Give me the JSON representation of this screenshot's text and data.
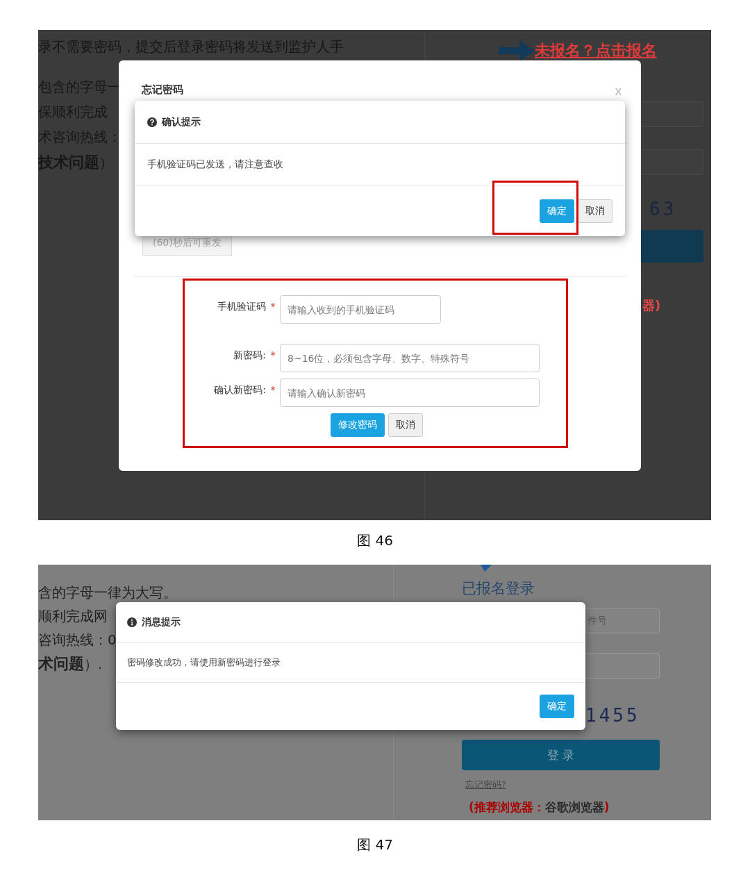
{
  "figure_46": {
    "caption": "图 46",
    "page_behind": {
      "top_text": "录不需要密码，提交后登录密码将发送到监护人手",
      "notice_lines": [
        "包含的字母一",
        "保顺利完成",
        "术咨询热线：",
        "**技术问题**）"
      ],
      "register_link": "未报名？点击报名",
      "captcha": "63",
      "browser_note_tail": "器)"
    },
    "forgot_password_modal": {
      "title": "忘记密码",
      "close": "x",
      "resend_button": {
        "label": "(60)秒后可重发",
        "disabled": true
      },
      "form_highlighted": true,
      "fields": [
        {
          "label": "手机验证码",
          "required_mark": "*",
          "placeholder": "请输入收到的手机验证码",
          "kind": "short"
        },
        {
          "label": "新密码:",
          "required_mark": "*",
          "placeholder": "8~16位，必须包含字母、数字、特殊符号",
          "kind": "long"
        },
        {
          "label": "确认新密码:",
          "required_mark": "*",
          "placeholder": "请输入确认新密码",
          "kind": "long"
        }
      ],
      "buttons": [
        {
          "label": "修改密码",
          "kind": "primary"
        },
        {
          "label": "取消",
          "kind": "default"
        }
      ]
    },
    "confirm_dialog": {
      "title": "确认提示",
      "message": "手机验证码已发送，请注意查收",
      "buttons_highlighted": true,
      "buttons": [
        {
          "label": "确定",
          "kind": "primary"
        },
        {
          "label": "取消",
          "kind": "default"
        }
      ]
    }
  },
  "figure_47": {
    "caption": "图 47",
    "page_behind": {
      "notice_lines": [
        "含的字母一律为大写。",
        "顺利完成网",
        "咨询热线：0",
        "**术问题**）."
      ],
      "login_title": "已报名登录",
      "id_field_placeholder": "件号",
      "captcha": "1455",
      "login_button": "登 录",
      "forgot_link": "忘记密码?",
      "browser_note": {
        "label": "(推荐浏览器：",
        "value": "谷歌浏览器",
        "end": ")"
      }
    },
    "message_dialog": {
      "title": "消息提示",
      "message": "密码修改成功，请使用新密码进行登录",
      "buttons": [
        {
          "label": "确定",
          "kind": "primary"
        }
      ]
    }
  }
}
